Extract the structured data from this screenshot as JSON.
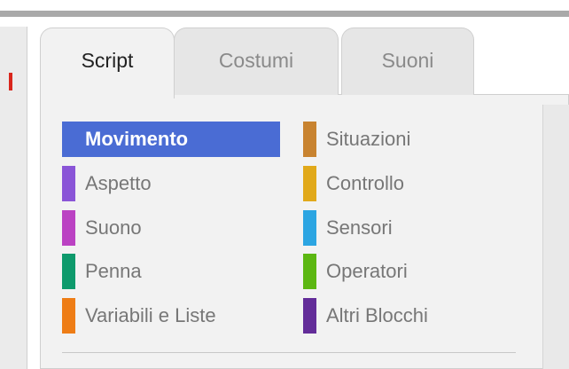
{
  "tabs": [
    {
      "label": "Script"
    },
    {
      "label": "Costumi"
    },
    {
      "label": "Suoni"
    }
  ],
  "categories": {
    "left": [
      {
        "label": "Movimento",
        "color": "#4a6cd4",
        "selected": true
      },
      {
        "label": "Aspetto",
        "color": "#8a55d7"
      },
      {
        "label": "Suono",
        "color": "#bb42c3"
      },
      {
        "label": "Penna",
        "color": "#0e9a6c"
      },
      {
        "label": "Variabili e Liste",
        "color": "#ee7d16"
      }
    ],
    "right": [
      {
        "label": "Situazioni",
        "color": "#c88330"
      },
      {
        "label": "Controllo",
        "color": "#e1a91a"
      },
      {
        "label": "Sensori",
        "color": "#2ca5e2"
      },
      {
        "label": "Operatori",
        "color": "#5cb712"
      },
      {
        "label": "Altri Blocchi",
        "color": "#632d99"
      }
    ]
  }
}
